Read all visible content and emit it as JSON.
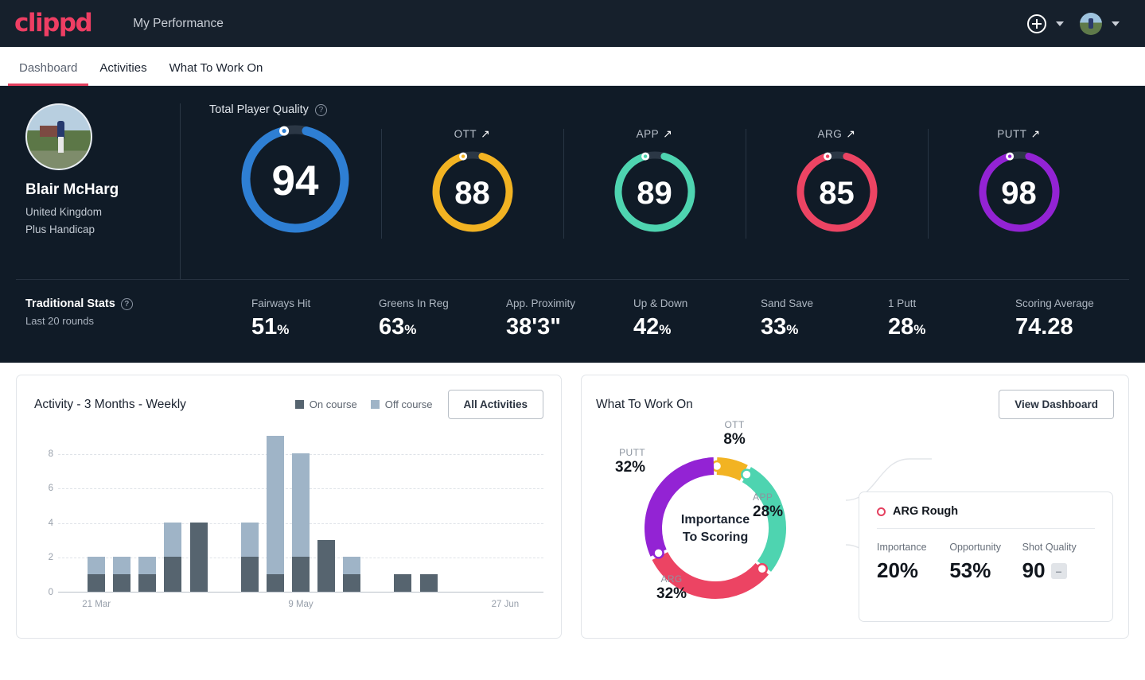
{
  "brand": {
    "logo_text": "clippd",
    "accent": "#e4405f"
  },
  "topbar": {
    "title": "My Performance",
    "add_icon": "plus-circle-icon",
    "add_caret": "chevron-down-icon",
    "avatar_icon": "user-avatar-icon",
    "avatar_caret": "chevron-down-icon"
  },
  "tabs": [
    {
      "label": "Dashboard",
      "active": true
    },
    {
      "label": "Activities",
      "active": false
    },
    {
      "label": "What To Work On",
      "active": false
    }
  ],
  "profile": {
    "name": "Blair McHarg",
    "country": "United Kingdom",
    "handicap": "Plus Handicap",
    "avatar_icon": "player-photo"
  },
  "quality": {
    "heading": "Total Player Quality",
    "help_icon": "question-circle-icon",
    "gauges": [
      {
        "label": "",
        "value": "94",
        "color": "#2e7fd4",
        "trend": "",
        "size": "big",
        "pct": 94
      },
      {
        "label": "OTT",
        "value": "88",
        "color": "#f2b322",
        "trend": "↗",
        "size": "sm",
        "pct": 88
      },
      {
        "label": "APP",
        "value": "89",
        "color": "#4ed4b0",
        "trend": "↗",
        "size": "sm",
        "pct": 89
      },
      {
        "label": "ARG",
        "value": "85",
        "color": "#ec4463",
        "trend": "↗",
        "size": "sm",
        "pct": 85
      },
      {
        "label": "PUTT",
        "value": "98",
        "color": "#9323d4",
        "trend": "↗",
        "size": "sm",
        "pct": 98
      }
    ]
  },
  "traditional": {
    "heading": "Traditional Stats",
    "help_icon": "question-circle-icon",
    "subtitle": "Last 20 rounds",
    "stats": [
      {
        "label": "Fairways Hit",
        "value": "51",
        "unit": "%"
      },
      {
        "label": "Greens In Reg",
        "value": "63",
        "unit": "%"
      },
      {
        "label": "App. Proximity",
        "value": "38'3\"",
        "unit": ""
      },
      {
        "label": "Up & Down",
        "value": "42",
        "unit": "%"
      },
      {
        "label": "Sand Save",
        "value": "33",
        "unit": "%"
      },
      {
        "label": "1 Putt",
        "value": "28",
        "unit": "%"
      },
      {
        "label": "Scoring Average",
        "value": "74.28",
        "unit": ""
      }
    ]
  },
  "activity_card": {
    "title": "Activity - 3 Months - Weekly",
    "legend": [
      {
        "label": "On course",
        "color": "#56646f"
      },
      {
        "label": "Off course",
        "color": "#9fb4c7"
      }
    ],
    "button": "All Activities"
  },
  "work_card": {
    "title": "What To Work On",
    "button": "View Dashboard",
    "center_line1": "Importance",
    "center_line2": "To Scoring",
    "connector_icon": "bracket-connector",
    "detail": {
      "title": "ARG Rough",
      "marker_icon": "ring-marker-icon",
      "metrics": [
        {
          "label": "Importance",
          "value": "20%",
          "chip": ""
        },
        {
          "label": "Opportunity",
          "value": "53%",
          "chip": ""
        },
        {
          "label": "Shot Quality",
          "value": "90",
          "chip": "–"
        }
      ]
    }
  },
  "chart_data": [
    {
      "type": "bar",
      "title": "Activity - 3 Months - Weekly",
      "stacked": true,
      "xlabel": "",
      "ylabel": "",
      "ylim": [
        0,
        9
      ],
      "yticks": [
        0,
        2,
        4,
        6,
        8
      ],
      "grid": true,
      "legend_position": "top-right",
      "categories": [
        "",
        "21 Mar",
        "",
        "",
        "",
        "",
        "",
        "",
        "",
        "9 May",
        "",
        "",
        "",
        "",
        "",
        "",
        "",
        "27 Jun",
        ""
      ],
      "tick_labels": [
        {
          "index": 1,
          "label": "21 Mar"
        },
        {
          "index": 9,
          "label": "9 May"
        },
        {
          "index": 17,
          "label": "27 Jun"
        }
      ],
      "series": [
        {
          "name": "On course",
          "color": "#56646f",
          "values": [
            0,
            1,
            1,
            1,
            2,
            4,
            0,
            2,
            1,
            2,
            3,
            1,
            0,
            1,
            1,
            0,
            0,
            0,
            0
          ]
        },
        {
          "name": "Off course",
          "color": "#9fb4c7",
          "values": [
            0,
            1,
            1,
            1,
            2,
            0,
            0,
            2,
            8,
            6,
            0,
            1,
            0,
            0,
            0,
            0,
            0,
            0,
            0
          ]
        }
      ],
      "totals": [
        0,
        2,
        2,
        2,
        4,
        4,
        0,
        4,
        9,
        8,
        3,
        2,
        0,
        1,
        1,
        0,
        0,
        0,
        0
      ]
    },
    {
      "type": "pie",
      "title": "Importance To Scoring",
      "donut": true,
      "labels": [
        "OTT",
        "APP",
        "ARG",
        "PUTT"
      ],
      "values": [
        8,
        28,
        32,
        32
      ],
      "value_labels": [
        "8%",
        "28%",
        "32%",
        "32%"
      ],
      "colors": [
        "#f2b322",
        "#4ed4b0",
        "#ec4463",
        "#9323d4"
      ],
      "legend_position": "around"
    }
  ]
}
